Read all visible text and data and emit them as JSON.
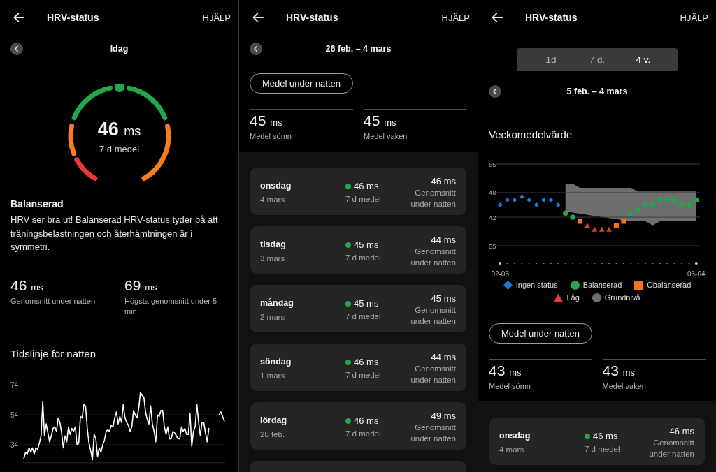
{
  "panels": [
    {
      "header": {
        "title": "HRV-status",
        "action": "HJÄLP"
      },
      "date_nav": {
        "label": "Idag"
      },
      "gauge": {
        "value": "46",
        "unit": "ms",
        "caption": "7 d medel",
        "level": 0.5
      },
      "status": {
        "title": "Balanserad",
        "text": "HRV ser bra ut! Balanserad HRV-status tyder på att träningsbelastningen och återhämtningen är i symmetri."
      },
      "stats": [
        {
          "value": "46",
          "unit": "ms",
          "label": "Genomsnitt under natten"
        },
        {
          "value": "69",
          "unit": "ms",
          "label": "Högsta genomsnitt under 5 min"
        }
      ],
      "timeline": {
        "chart_data": {
          "type": "line",
          "title": "Tidslinje för natten",
          "grid": true,
          "ylim": [
            22,
            74
          ],
          "yticks": [
            34,
            54,
            74
          ],
          "series": [
            {
              "color": "#ffffff",
              "values": [
                25,
                29,
                28,
                32,
                29,
                32,
                28,
                32,
                31,
                35,
                40,
                63,
                40,
                48,
                42,
                36,
                40,
                45,
                46,
                43,
                52,
                49,
                42,
                32,
                40,
                36,
                46,
                41,
                45,
                43,
                46,
                34,
                35,
                53,
                52,
                61,
                60,
                45,
                35,
                30,
                24,
                41,
                38,
                26,
                32,
                29,
                34,
                37,
                43,
                44,
                43,
                47,
                46,
                52,
                56,
                48,
                53,
                49,
                61,
                52,
                49,
                47,
                43,
                46,
                57,
                54,
                52,
                58,
                69,
                67,
                66,
                56,
                51,
                48,
                60,
                48,
                43,
                36,
                54,
                53,
                57,
                57,
                46,
                41,
                46,
                38,
                38,
                43,
                42,
                40,
                38,
                38,
                46,
                43,
                45,
                41,
                41,
                55,
                33,
                43,
                46,
                61,
                49,
                40,
                49,
                49,
                42,
                36,
                45,
                null,
                null,
                null,
                null,
                null,
                null,
                null,
                null,
                null
              ]
            },
            {
              "color": "#ffffff",
              "values": [
                null,
                null,
                null,
                null,
                null,
                null,
                null,
                null,
                null,
                null,
                null,
                null,
                null,
                null,
                null,
                null,
                null,
                null,
                null,
                null,
                null,
                null,
                null,
                null,
                null,
                null,
                null,
                null,
                null,
                null,
                null,
                null,
                null,
                null,
                null,
                null,
                null,
                null,
                null,
                null,
                null,
                null,
                null,
                null,
                null,
                null,
                null,
                null,
                null,
                null,
                null,
                null,
                null,
                null,
                null,
                null,
                null,
                null,
                null,
                null,
                null,
                null,
                null,
                null,
                null,
                null,
                null,
                null,
                null,
                null,
                null,
                null,
                null,
                null,
                null,
                null,
                null,
                null,
                null,
                null,
                null,
                null,
                null,
                null,
                null,
                null,
                null,
                null,
                null,
                null,
                null,
                null,
                null,
                null,
                null,
                null,
                null,
                null,
                null,
                null,
                null,
                null,
                null,
                null,
                null,
                null,
                null,
                null,
                null,
                null,
                null,
                null,
                null,
                null,
                54,
                56,
                53,
                50
              ]
            }
          ]
        }
      }
    },
    {
      "header": {
        "title": "HRV-status",
        "action": "HJÄLP"
      },
      "date_nav": {
        "label": "26 feb. – 4 mars"
      },
      "filter_button": "Medel under natten",
      "stats": [
        {
          "value": "45",
          "unit": "ms",
          "label": "Medel sömn"
        },
        {
          "value": "45",
          "unit": "ms",
          "label": "Medel vaken"
        }
      ],
      "days": [
        {
          "day": "onsdag",
          "date": "4 mars",
          "color": "#22a84c",
          "weekly_average": "46 ms",
          "weekly_label": "7 d medel",
          "night_average": "46 ms",
          "night_label": "Genomsnitt under natten"
        },
        {
          "day": "tisdag",
          "date": "3 mars",
          "color": "#22a84c",
          "weekly_average": "45 ms",
          "weekly_label": "7 d medel",
          "night_average": "44 ms",
          "night_label": "Genomsnitt under natten"
        },
        {
          "day": "måndag",
          "date": "2 mars",
          "color": "#22a84c",
          "weekly_average": "45 ms",
          "weekly_label": "7 d medel",
          "night_average": "45 ms",
          "night_label": "Genomsnitt under natten"
        },
        {
          "day": "söndag",
          "date": "1 mars",
          "color": "#22a84c",
          "weekly_average": "46 ms",
          "weekly_label": "7 d medel",
          "night_average": "44 ms",
          "night_label": "Genomsnitt under natten"
        },
        {
          "day": "lördag",
          "date": "28 feb.",
          "color": "#22a84c",
          "weekly_average": "46 ms",
          "weekly_label": "7 d medel",
          "night_average": "49 ms",
          "night_label": "Genomsnitt under natten"
        }
      ]
    },
    {
      "header": {
        "title": "HRV-status",
        "action": "HJÄLP"
      },
      "range_tabs": [
        {
          "label": "1d",
          "selected": false
        },
        {
          "label": "7 d.",
          "selected": false
        },
        {
          "label": "4 v.",
          "selected": true
        }
      ],
      "date_nav": {
        "label": "5 feb. – 4 mars"
      },
      "weekly": {
        "chart_data": {
          "type": "scatter",
          "title": "Veckomedelvärde",
          "grid": true,
          "categories": [
            "02-05",
            null,
            null,
            null,
            null,
            null,
            null,
            null,
            null,
            null,
            null,
            null,
            null,
            null,
            null,
            null,
            null,
            null,
            null,
            null,
            null,
            null,
            null,
            null,
            null,
            null,
            null,
            "03-04"
          ],
          "ylim": [
            35,
            55
          ],
          "yticks": [
            35,
            42,
            48,
            55
          ],
          "series": [
            {
              "name": "Ingen status",
              "color": "#1f78d1",
              "marker": "diamond",
              "values": [
                45,
                46.2,
                46.2,
                47,
                46.2,
                45,
                46.2,
                46.2,
                45,
                null,
                null,
                null,
                null,
                null,
                null,
                null,
                null,
                null,
                null,
                null,
                null,
                null,
                null,
                null,
                null,
                null,
                null,
                null
              ]
            },
            {
              "name": "Balanserad",
              "color": "#22a84c",
              "marker": "circle",
              "values": [
                null,
                null,
                null,
                null,
                null,
                null,
                null,
                null,
                null,
                43,
                42,
                null,
                null,
                null,
                null,
                null,
                null,
                null,
                43,
                44,
                45,
                45,
                46.2,
                46.2,
                46.2,
                45,
                45,
                46.2
              ]
            },
            {
              "name": "Obalanserad",
              "color": "#f2761c",
              "marker": "square",
              "values": [
                null,
                null,
                null,
                null,
                null,
                null,
                null,
                null,
                null,
                null,
                null,
                41,
                null,
                null,
                null,
                null,
                40,
                41,
                null,
                null,
                null,
                null,
                null,
                null,
                null,
                null,
                null,
                null
              ]
            },
            {
              "name": "Låg",
              "color": "#e03a3a",
              "marker": "triangle",
              "values": [
                null,
                null,
                null,
                null,
                null,
                null,
                null,
                null,
                null,
                null,
                null,
                null,
                40,
                39,
                39,
                39,
                null,
                null,
                null,
                null,
                null,
                null,
                null,
                null,
                null,
                null,
                null,
                null
              ]
            }
          ]
        },
        "baseline": {
          "label": "Grundnivå",
          "color": "#6e6e6e"
        }
      },
      "filter_button": "Medel under natten",
      "stats": [
        {
          "value": "43",
          "unit": "ms",
          "label": "Medel sömn"
        },
        {
          "value": "43",
          "unit": "ms",
          "label": "Medel vaken"
        }
      ],
      "days": [
        {
          "day": "onsdag",
          "date": "4 mars",
          "color": "#22a84c",
          "weekly_average": "46 ms",
          "weekly_label": "7 d medel",
          "night_average": "46 ms",
          "night_label": "Genomsnitt under natten"
        }
      ]
    }
  ]
}
